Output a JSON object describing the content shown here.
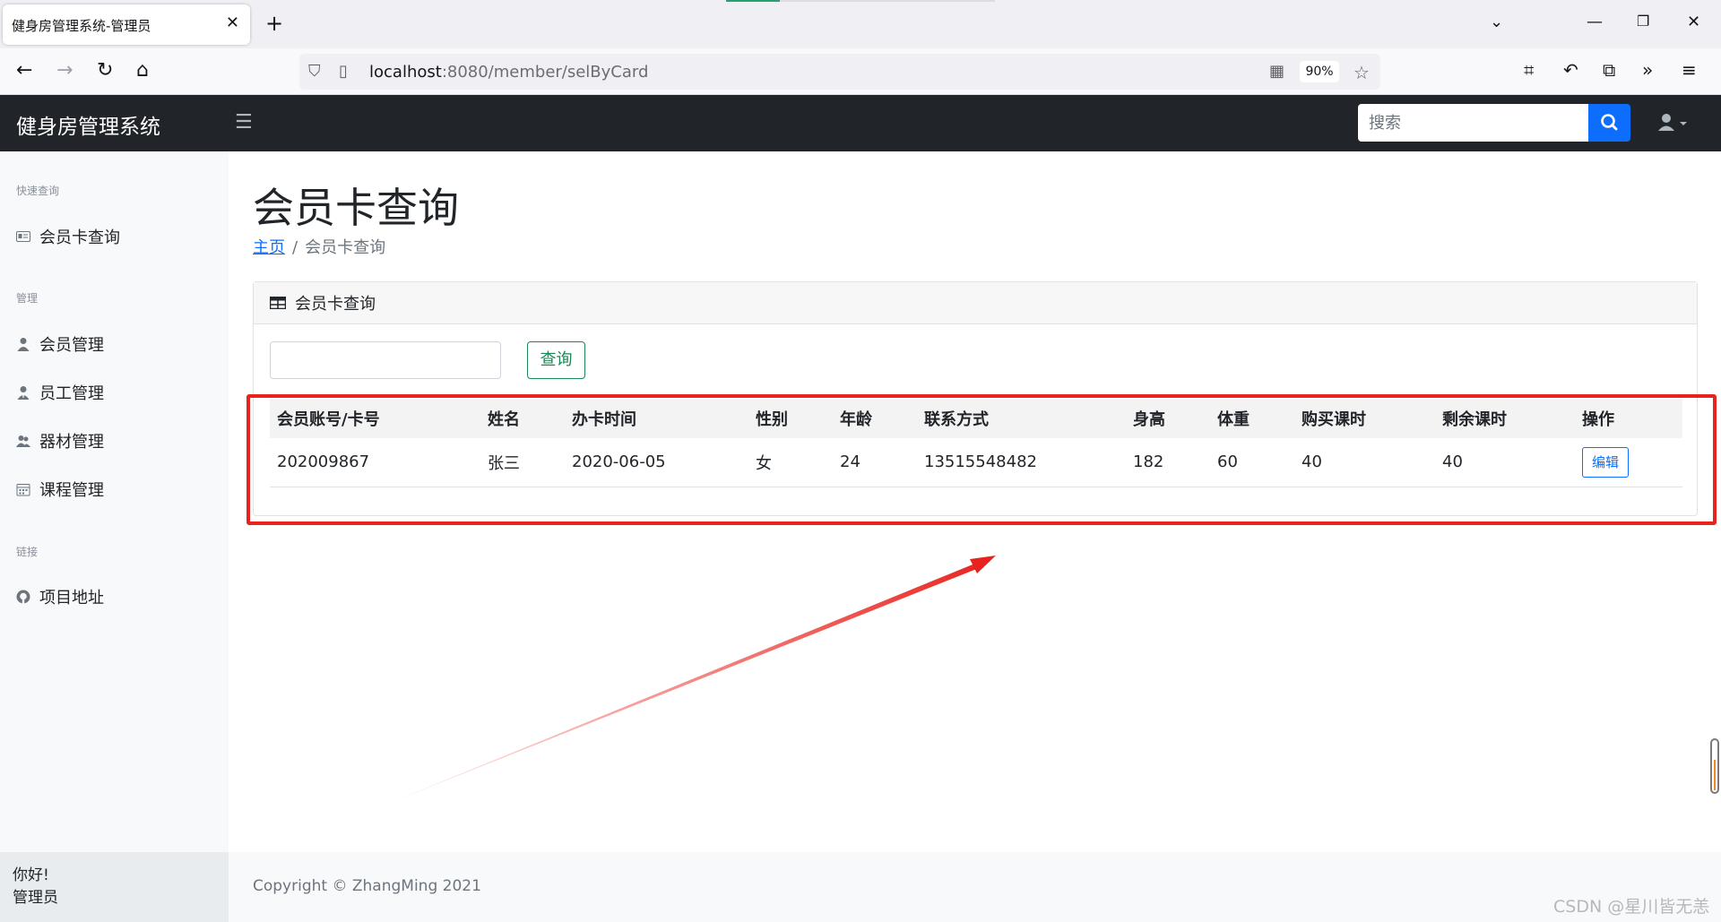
{
  "browser": {
    "tab_title": "健身房管理系统-管理员",
    "url_host": "localhost",
    "url_path": ":8080/member/selByCard",
    "zoom": "90%"
  },
  "app": {
    "brand": "健身房管理系统",
    "search_placeholder": "搜索"
  },
  "sidebar": {
    "sections": [
      {
        "heading": "快速查询",
        "items": [
          "会员卡查询"
        ]
      },
      {
        "heading": "管理",
        "items": [
          "会员管理",
          "员工管理",
          "器材管理",
          "课程管理"
        ]
      },
      {
        "heading": "链接",
        "items": [
          "项目地址"
        ]
      }
    ],
    "greeting": "你好!",
    "role": "管理员"
  },
  "main": {
    "title": "会员卡查询",
    "breadcrumb_home": "主页",
    "breadcrumb_current": "会员卡查询",
    "card_header": "会员卡查询",
    "query_button": "查询",
    "table": {
      "headers": [
        "会员账号/卡号",
        "姓名",
        "办卡时间",
        "性别",
        "年龄",
        "联系方式",
        "身高",
        "体重",
        "购买课时",
        "剩余课时",
        "操作"
      ],
      "rows": [
        [
          "202009867",
          "张三",
          "2020-06-05",
          "女",
          "24",
          "13515548482",
          "182",
          "60",
          "40",
          "40"
        ]
      ],
      "edit_label": "编辑"
    }
  },
  "footer": {
    "copyright": "Copyright © ZhangMing 2021"
  },
  "watermark": "CSDN @星川皆无恙",
  "colors": {
    "header_bg": "#212529",
    "primary": "#0d6efd",
    "success": "#198754",
    "annotation_red": "#e8221d"
  }
}
